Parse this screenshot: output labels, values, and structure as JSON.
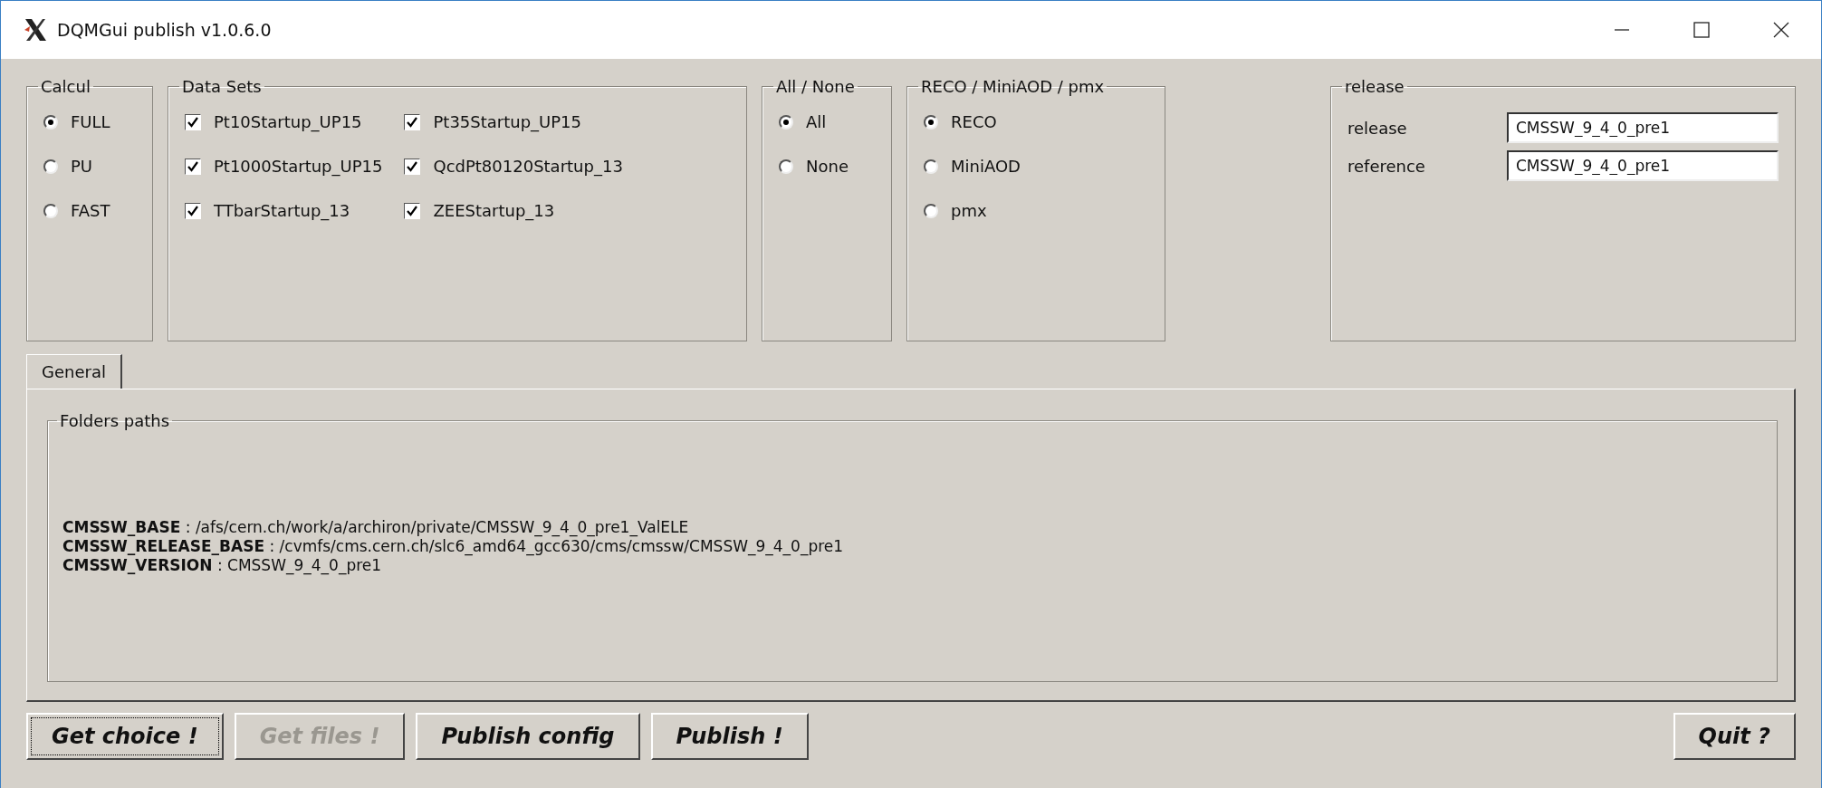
{
  "window": {
    "title": "DQMGui publish v1.0.6.0"
  },
  "calcul": {
    "title": "Calcul",
    "options": [
      {
        "label": "FULL",
        "selected": true
      },
      {
        "label": "PU",
        "selected": false
      },
      {
        "label": "FAST",
        "selected": false
      }
    ]
  },
  "data_sets": {
    "title": "Data Sets",
    "items": [
      {
        "label": "Pt10Startup_UP15",
        "checked": true
      },
      {
        "label": "Pt35Startup_UP15",
        "checked": true
      },
      {
        "label": "Pt1000Startup_UP15",
        "checked": true
      },
      {
        "label": "QcdPt80120Startup_13",
        "checked": true
      },
      {
        "label": "TTbarStartup_13",
        "checked": true
      },
      {
        "label": "ZEEStartup_13",
        "checked": true
      }
    ]
  },
  "all_none": {
    "title": "All / None",
    "options": [
      {
        "label": "All",
        "selected": true
      },
      {
        "label": "None",
        "selected": false
      }
    ]
  },
  "reco_type": {
    "title": "RECO / MiniAOD / pmx",
    "options": [
      {
        "label": "RECO",
        "selected": true
      },
      {
        "label": "MiniAOD",
        "selected": false
      },
      {
        "label": "pmx",
        "selected": false
      }
    ]
  },
  "release": {
    "title": "release",
    "fields": [
      {
        "label": "release",
        "value": "CMSSW_9_4_0_pre1"
      },
      {
        "label": "reference",
        "value": "CMSSW_9_4_0_pre1"
      }
    ]
  },
  "tabs": [
    {
      "label": "General",
      "selected": true
    }
  ],
  "folders": {
    "title": "Folders paths",
    "lines": [
      "**CMSSW_BASE** : /afs/cern.ch/work/a/archiron/private/CMSSW_9_4_0_pre1_ValELE",
      "**CMSSW_RELEASE_BASE** : /cvmfs/cms.cern.ch/slc6_amd64_gcc630/cms/cmssw/CMSSW_9_4_0_pre1",
      "**CMSSW_VERSION** : CMSSW_9_4_0_pre1"
    ]
  },
  "buttons": [
    {
      "label": "Get choice !",
      "disabled": false,
      "focused": true
    },
    {
      "label": "Get files !",
      "disabled": true,
      "focused": false
    },
    {
      "label": "Publish config",
      "disabled": false,
      "focused": false
    },
    {
      "label": "Publish !",
      "disabled": false,
      "focused": false
    }
  ],
  "quit_button": {
    "label": "Quit ?"
  }
}
